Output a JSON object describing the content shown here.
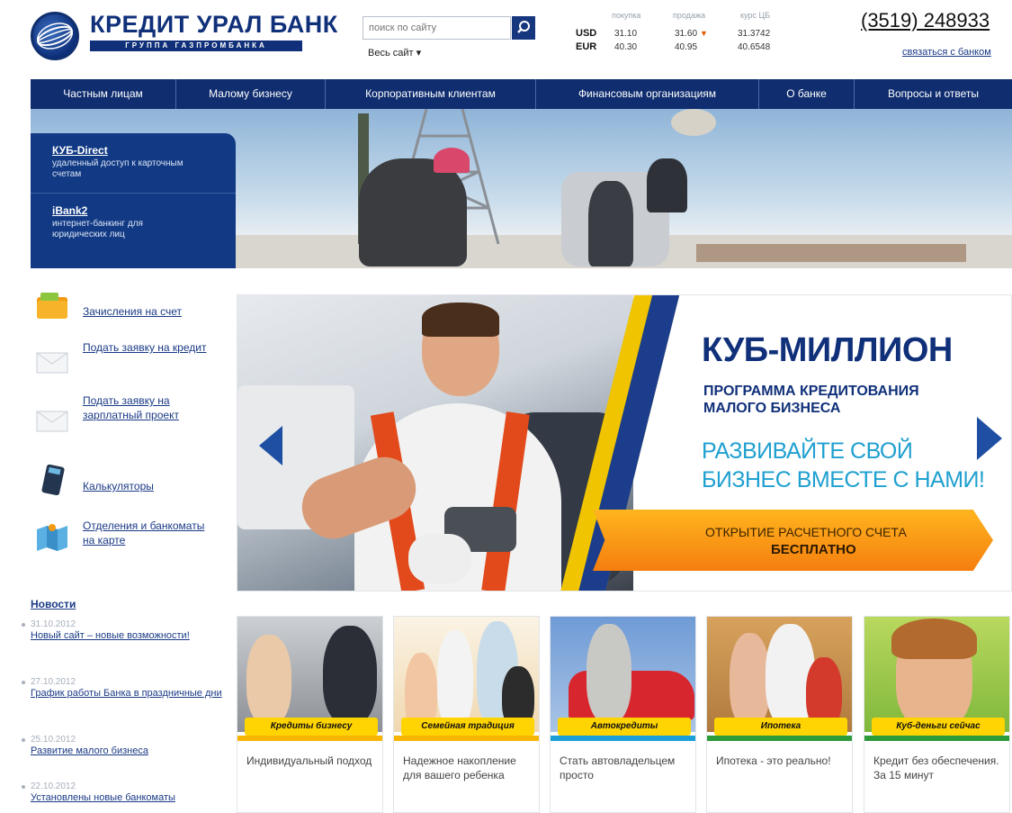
{
  "brand": {
    "name": "КРЕДИТ УРАЛ БАНК",
    "subtitle": "ГРУППА ГАЗПРОМБАНКА"
  },
  "search": {
    "placeholder": "поиск по сайту",
    "scope": "Весь сайт ▾"
  },
  "rates": {
    "headers": [
      "покупка",
      "продажа",
      "курс ЦБ"
    ],
    "rows": [
      {
        "currency": "USD",
        "buy": "31.10",
        "sell": "31.60",
        "cb": "31.3742"
      },
      {
        "currency": "EUR",
        "buy": "40.30",
        "sell": "40.95",
        "cb": "40.6548"
      }
    ]
  },
  "contact": {
    "phone": "(3519) 248933",
    "link": "связаться с банком"
  },
  "nav": [
    "Частным лицам",
    "Малому бизнесу",
    "Корпоративным клиентам",
    "Финансовым организациям",
    "О банке",
    "Вопросы и ответы"
  ],
  "hero_panel": [
    {
      "title": "КУБ-Direct",
      "desc": "удаленный доступ к карточным счетам"
    },
    {
      "title": "iBank2",
      "desc": "интернет-банкинг для юридических лиц"
    }
  ],
  "quick_links": [
    {
      "label": "Зачисления на счет",
      "icon": "wallet-icon"
    },
    {
      "label": "Подать заявку на кредит",
      "icon": "envelope-icon"
    },
    {
      "label": "Подать заявку на зарплатный проект",
      "icon": "envelope-icon"
    },
    {
      "label": "Калькуляторы",
      "icon": "calculator-icon"
    },
    {
      "label": "Отделения и банкоматы на карте",
      "icon": "map-icon"
    }
  ],
  "news": {
    "title": "Новости",
    "items": [
      {
        "date": "31.10.2012",
        "title": "Новый сайт – новые возможности!"
      },
      {
        "date": "27.10.2012",
        "title": "График работы Банка в праздничные дни"
      },
      {
        "date": "25.10.2012",
        "title": "Развитие малого бизнеса"
      },
      {
        "date": "22.10.2012",
        "title": "Установлены новые банкоматы"
      }
    ]
  },
  "banner": {
    "title": "КУБ-МИЛЛИОН",
    "subtitle": "ПРОГРАММА КРЕДИТОВАНИЯ МАЛОГО БИЗНЕСА",
    "slogan": "РАЗВИВАЙТЕ СВОЙ БИЗНЕС ВМЕСТЕ С НАМИ!",
    "cta_line1": "ОТКРЫТИЕ РАСЧЕТНОГО СЧЕТА",
    "cta_line2": "БЕСПЛАТНО"
  },
  "products": [
    {
      "tag": "Кредиты бизнесу",
      "text": "Индивидуальный подход",
      "color": "#f7b500"
    },
    {
      "tag": "Семейная традиция",
      "text": "Надежное накопление для вашего ребенка",
      "color": "#f7b500"
    },
    {
      "tag": "Автокредиты",
      "text": "Стать автовладельцем просто",
      "color": "#1aa0d6"
    },
    {
      "tag": "Ипотека",
      "text": "Ипотека - это реально!",
      "color": "#2e9b3a"
    },
    {
      "tag": "Куб-деньги сейчас",
      "text": "Кредит без обеспечения. За 15 минут",
      "color": "#2e9b3a"
    }
  ],
  "colors": {
    "brand_navy": "#0f2d6f",
    "accent_blue": "#1fa0d0",
    "cta_orange": "#f57e0f",
    "tag_yellow": "#ffd400"
  }
}
